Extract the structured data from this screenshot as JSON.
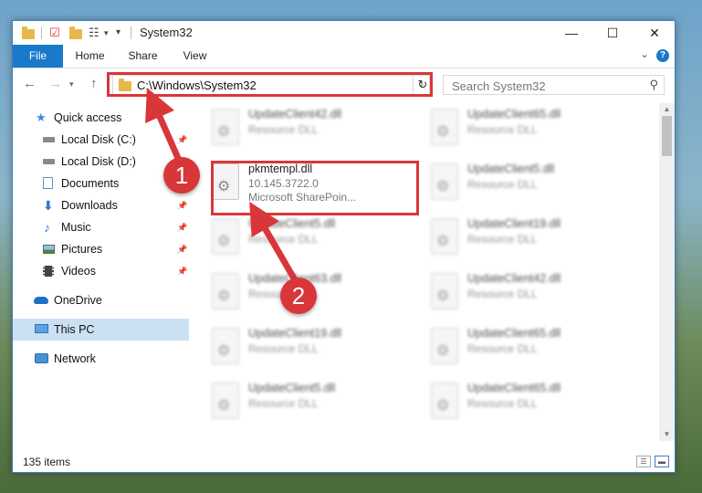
{
  "window": {
    "title": "System32",
    "controls": {
      "minimize": "—",
      "maximize": "☐",
      "close": "✕"
    }
  },
  "ribbon": {
    "tabs": [
      {
        "label": "File"
      },
      {
        "label": "Home"
      },
      {
        "label": "Share"
      },
      {
        "label": "View"
      }
    ],
    "help": "?"
  },
  "address_bar": {
    "path": "C:\\Windows\\System32"
  },
  "search": {
    "placeholder": "Search System32"
  },
  "nav_pane": {
    "items": [
      {
        "label": "Quick access",
        "icon": "star-icon"
      },
      {
        "label": "Local Disk (C:)",
        "icon": "drive-icon",
        "pinned": true
      },
      {
        "label": "Local Disk (D:)",
        "icon": "drive-icon"
      },
      {
        "label": "Documents",
        "icon": "documents-icon",
        "pinned": true
      },
      {
        "label": "Downloads",
        "icon": "download-icon",
        "pinned": true
      },
      {
        "label": "Music",
        "icon": "music-icon",
        "pinned": true
      },
      {
        "label": "Pictures",
        "icon": "pictures-icon",
        "pinned": true
      },
      {
        "label": "Videos",
        "icon": "videos-icon",
        "pinned": true
      },
      {
        "label": "OneDrive",
        "icon": "cloud-icon"
      },
      {
        "label": "This PC",
        "icon": "computer-icon",
        "selected": true
      },
      {
        "label": "Network",
        "icon": "network-icon"
      }
    ]
  },
  "files": {
    "highlighted": {
      "name": "pkmtempl.dll",
      "version": "10.145.3722.0",
      "description": "Microsoft SharePoin..."
    },
    "left_column": [
      {
        "name": "UpdateClient42.dll",
        "type": "Resource DLL"
      },
      {
        "name": "UpdateClient5.dll",
        "type": "Resource DLL"
      },
      {
        "name": "UpdateClient63.dll",
        "type": "Resource DLL"
      },
      {
        "name": "UpdateClient19.dll",
        "type": "Resource DLL"
      },
      {
        "name": "UpdateClient5.dll",
        "type": "Resource DLL"
      }
    ],
    "right_column": [
      {
        "name": "UpdateClient65.dll",
        "type": "Resource DLL"
      },
      {
        "name": "UpdateClient5.dll",
        "type": "Resource DLL"
      },
      {
        "name": "UpdateClient19.dll",
        "type": "Resource DLL"
      },
      {
        "name": "UpdateClient42.dll",
        "type": "Resource DLL"
      },
      {
        "name": "UpdateClient65.dll",
        "type": "Resource DLL"
      },
      {
        "name": "UpdateClient65.dll",
        "type": "Resource DLL"
      }
    ]
  },
  "status_bar": {
    "item_count": "135 items"
  },
  "annotations": {
    "step1": "1",
    "step2": "2"
  },
  "colors": {
    "accent": "#1979ca",
    "annotation_red": "#d9363a",
    "selection": "#cce0f4"
  }
}
